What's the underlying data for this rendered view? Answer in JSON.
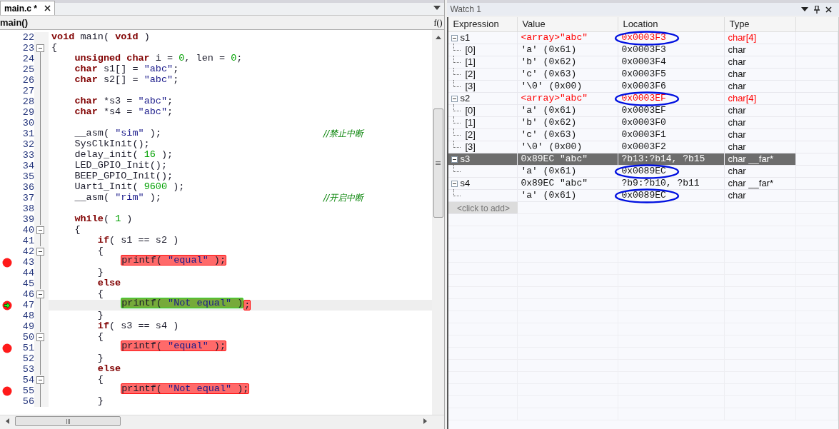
{
  "editor": {
    "tab": {
      "label": "main.c *",
      "selected": true
    },
    "function_name": "main()",
    "function_button": "f()",
    "lines": [
      {
        "number": "22",
        "collapsible": false,
        "breakpoint": false,
        "current": false,
        "segments": [
          {
            "kind": "keyword",
            "text": "void"
          },
          {
            "kind": "plain",
            "text": " main( "
          },
          {
            "kind": "keyword",
            "text": "void"
          },
          {
            "kind": "plain",
            "text": " )"
          }
        ]
      },
      {
        "number": "23",
        "collapsible": true,
        "breakpoint": false,
        "current": false,
        "segments": [
          {
            "kind": "plain",
            "text": "{"
          }
        ]
      },
      {
        "number": "24",
        "collapsible": false,
        "breakpoint": false,
        "current": false,
        "segments": [
          {
            "kind": "keyword",
            "text": "    unsigned char"
          },
          {
            "kind": "plain",
            "text": " i = "
          },
          {
            "kind": "number",
            "text": "0"
          },
          {
            "kind": "plain",
            "text": ", len = "
          },
          {
            "kind": "number",
            "text": "0"
          },
          {
            "kind": "plain",
            "text": ";"
          }
        ]
      },
      {
        "number": "25",
        "collapsible": false,
        "breakpoint": false,
        "current": false,
        "segments": [
          {
            "kind": "keyword",
            "text": "    char"
          },
          {
            "kind": "plain",
            "text": " s1[] = "
          },
          {
            "kind": "string",
            "text": "\"abc\""
          },
          {
            "kind": "plain",
            "text": ";"
          }
        ]
      },
      {
        "number": "26",
        "collapsible": false,
        "breakpoint": false,
        "current": false,
        "segments": [
          {
            "kind": "keyword",
            "text": "    char"
          },
          {
            "kind": "plain",
            "text": " s2[] = "
          },
          {
            "kind": "string",
            "text": "\"abc\""
          },
          {
            "kind": "plain",
            "text": ";"
          }
        ]
      },
      {
        "number": "27",
        "collapsible": false,
        "breakpoint": false,
        "current": false
      },
      {
        "number": "28",
        "collapsible": false,
        "breakpoint": false,
        "current": false,
        "segments": [
          {
            "kind": "keyword",
            "text": "    char"
          },
          {
            "kind": "plain",
            "text": " *s3 = "
          },
          {
            "kind": "string",
            "text": "\"abc\""
          },
          {
            "kind": "plain",
            "text": ";"
          }
        ]
      },
      {
        "number": "29",
        "collapsible": false,
        "breakpoint": false,
        "current": false,
        "segments": [
          {
            "kind": "keyword",
            "text": "    char"
          },
          {
            "kind": "plain",
            "text": " *s4 = "
          },
          {
            "kind": "string",
            "text": "\"abc\""
          },
          {
            "kind": "plain",
            "text": ";"
          }
        ]
      },
      {
        "number": "30",
        "collapsible": false,
        "breakpoint": false,
        "current": false
      },
      {
        "number": "31",
        "collapsible": false,
        "breakpoint": false,
        "current": false,
        "segments": [
          {
            "kind": "plain",
            "text": "    __asm( "
          },
          {
            "kind": "string",
            "text": "\"sim\""
          },
          {
            "kind": "plain",
            "text": " );"
          },
          {
            "kind": "comment",
            "text": "//禁止中断"
          }
        ]
      },
      {
        "number": "32",
        "collapsible": false,
        "breakpoint": false,
        "current": false,
        "segments": [
          {
            "kind": "plain",
            "text": "    SysClkInit();"
          }
        ]
      },
      {
        "number": "33",
        "collapsible": false,
        "breakpoint": false,
        "current": false,
        "segments": [
          {
            "kind": "plain",
            "text": "    delay_init( "
          },
          {
            "kind": "number",
            "text": "16"
          },
          {
            "kind": "plain",
            "text": " );"
          }
        ]
      },
      {
        "number": "34",
        "collapsible": false,
        "breakpoint": false,
        "current": false,
        "segments": [
          {
            "kind": "plain",
            "text": "    LED_GPIO_Init();"
          }
        ]
      },
      {
        "number": "35",
        "collapsible": false,
        "breakpoint": false,
        "current": false,
        "segments": [
          {
            "kind": "plain",
            "text": "    BEEP_GPIO_Init();"
          }
        ]
      },
      {
        "number": "36",
        "collapsible": false,
        "breakpoint": false,
        "current": false,
        "segments": [
          {
            "kind": "plain",
            "text": "    Uart1_Init( "
          },
          {
            "kind": "number",
            "text": "9600"
          },
          {
            "kind": "plain",
            "text": " );"
          }
        ]
      },
      {
        "number": "37",
        "collapsible": false,
        "breakpoint": false,
        "current": false,
        "segments": [
          {
            "kind": "plain",
            "text": "    __asm( "
          },
          {
            "kind": "string",
            "text": "\"rim\""
          },
          {
            "kind": "plain",
            "text": " );"
          },
          {
            "kind": "comment",
            "text": "//开启中断"
          }
        ]
      },
      {
        "number": "38",
        "collapsible": false,
        "breakpoint": false,
        "current": false
      },
      {
        "number": "39",
        "collapsible": false,
        "breakpoint": false,
        "current": false,
        "segments": [
          {
            "kind": "keyword",
            "text": "    while"
          },
          {
            "kind": "plain",
            "text": "( "
          },
          {
            "kind": "number",
            "text": "1"
          },
          {
            "kind": "plain",
            "text": " )"
          }
        ]
      },
      {
        "number": "40",
        "collapsible": true,
        "breakpoint": false,
        "current": false,
        "segments": [
          {
            "kind": "plain",
            "text": "    {"
          }
        ]
      },
      {
        "number": "41",
        "collapsible": false,
        "breakpoint": false,
        "current": false,
        "segments": [
          {
            "kind": "keyword",
            "text": "        if"
          },
          {
            "kind": "plain",
            "text": "( s1 == s2 )"
          }
        ]
      },
      {
        "number": "42",
        "collapsible": true,
        "breakpoint": false,
        "current": false,
        "segments": [
          {
            "kind": "plain",
            "text": "        {"
          }
        ]
      },
      {
        "number": "43",
        "collapsible": false,
        "breakpoint": true,
        "current": false,
        "segments": [
          {
            "kind": "plain",
            "text": "            printf( ",
            "current": false
          },
          {
            "kind": "string",
            "text": "\"equal\"",
            "current": false
          },
          {
            "kind": "plain",
            "text": " );",
            "current": false
          }
        ]
      },
      {
        "number": "44",
        "collapsible": false,
        "breakpoint": false,
        "current": false,
        "segments": [
          {
            "kind": "plain",
            "text": "        }"
          }
        ]
      },
      {
        "number": "45",
        "collapsible": false,
        "breakpoint": false,
        "current": false,
        "segments": [
          {
            "kind": "keyword",
            "text": "        else"
          }
        ]
      },
      {
        "number": "46",
        "collapsible": true,
        "breakpoint": false,
        "current": false,
        "segments": [
          {
            "kind": "plain",
            "text": "        {"
          }
        ]
      },
      {
        "number": "47",
        "collapsible": false,
        "breakpoint": true,
        "current": true,
        "segments": [
          {
            "kind": "plain",
            "text": "            printf( ",
            "current": true
          },
          {
            "kind": "string",
            "text": "\"Not equal\"",
            "current": true
          },
          {
            "kind": "plain",
            "text": " )",
            "current": true
          },
          {
            "kind": "plain",
            "text": ";",
            "current": false
          }
        ]
      },
      {
        "number": "48",
        "collapsible": false,
        "breakpoint": false,
        "current": false,
        "segments": [
          {
            "kind": "plain",
            "text": "        }"
          }
        ]
      },
      {
        "number": "49",
        "collapsible": false,
        "breakpoint": false,
        "current": false,
        "segments": [
          {
            "kind": "keyword",
            "text": "        if"
          },
          {
            "kind": "plain",
            "text": "( s3 == s4 )"
          }
        ]
      },
      {
        "number": "50",
        "collapsible": true,
        "breakpoint": false,
        "current": false,
        "segments": [
          {
            "kind": "plain",
            "text": "        {"
          }
        ]
      },
      {
        "number": "51",
        "collapsible": false,
        "breakpoint": true,
        "current": false,
        "segments": [
          {
            "kind": "plain",
            "text": "            printf( ",
            "current": false
          },
          {
            "kind": "string",
            "text": "\"equal\"",
            "current": false
          },
          {
            "kind": "plain",
            "text": " );",
            "current": false
          }
        ]
      },
      {
        "number": "52",
        "collapsible": false,
        "breakpoint": false,
        "current": false,
        "segments": [
          {
            "kind": "plain",
            "text": "        }"
          }
        ]
      },
      {
        "number": "53",
        "collapsible": false,
        "breakpoint": false,
        "current": false,
        "segments": [
          {
            "kind": "keyword",
            "text": "        else"
          }
        ]
      },
      {
        "number": "54",
        "collapsible": true,
        "breakpoint": false,
        "current": false,
        "segments": [
          {
            "kind": "plain",
            "text": "        {"
          }
        ]
      },
      {
        "number": "55",
        "collapsible": false,
        "breakpoint": true,
        "current": false,
        "segments": [
          {
            "kind": "plain",
            "text": "            printf( ",
            "current": false
          },
          {
            "kind": "string",
            "text": "\"Not equal\"",
            "current": false
          },
          {
            "kind": "plain",
            "text": " );",
            "current": false
          }
        ]
      },
      {
        "number": "56",
        "collapsible": false,
        "breakpoint": false,
        "current": false,
        "segments": [
          {
            "kind": "plain",
            "text": "        }"
          }
        ]
      }
    ]
  },
  "watch": {
    "title": "Watch 1",
    "columns": [
      "Expression",
      "Value",
      "Location",
      "Type"
    ],
    "rows": [
      {
        "expression": "s1",
        "value": "<array>\"abc\"",
        "location": "0x0003F3",
        "type": "char[4]",
        "changed": true,
        "circled": true,
        "selected": false,
        "expanded": true,
        "children": [
          {
            "expression": "[0]",
            "value": "'a' (0x61)",
            "location": "0x0003F3",
            "type": "char",
            "changed": false,
            "circled": false,
            "selected": false
          },
          {
            "expression": "[1]",
            "value": "'b' (0x62)",
            "location": "0x0003F4",
            "type": "char",
            "changed": false,
            "circled": false,
            "selected": false
          },
          {
            "expression": "[2]",
            "value": "'c' (0x63)",
            "location": "0x0003F5",
            "type": "char",
            "changed": false,
            "circled": false,
            "selected": false
          },
          {
            "expression": "[3]",
            "value": "'\\0' (0x00)",
            "location": "0x0003F6",
            "type": "char",
            "changed": false,
            "circled": false,
            "selected": false
          }
        ]
      },
      {
        "expression": "s2",
        "value": "<array>\"abc\"",
        "location": "0x0003EF",
        "type": "char[4]",
        "changed": true,
        "circled": true,
        "selected": false,
        "expanded": true,
        "children": [
          {
            "expression": "[0]",
            "value": "'a' (0x61)",
            "location": "0x0003EF",
            "type": "char",
            "changed": false,
            "circled": false,
            "selected": false
          },
          {
            "expression": "[1]",
            "value": "'b' (0x62)",
            "location": "0x0003F0",
            "type": "char",
            "changed": false,
            "circled": false,
            "selected": false
          },
          {
            "expression": "[2]",
            "value": "'c' (0x63)",
            "location": "0x0003F1",
            "type": "char",
            "changed": false,
            "circled": false,
            "selected": false
          },
          {
            "expression": "[3]",
            "value": "'\\0' (0x00)",
            "location": "0x0003F2",
            "type": "char",
            "changed": false,
            "circled": false,
            "selected": false
          }
        ]
      },
      {
        "expression": "s3",
        "value": "0x89EC \"abc\"",
        "location": "?b13:?b14, ?b15",
        "type": "char __far*",
        "changed": false,
        "circled": false,
        "selected": true,
        "expanded": true,
        "children": [
          {
            "value": "'a' (0x61)",
            "location": "0x0089EC",
            "type": "char",
            "changed": false,
            "circled": true,
            "selected": false
          }
        ]
      },
      {
        "expression": "s4",
        "value": "0x89EC \"abc\"",
        "location": "?b9:?b10, ?b11",
        "type": "char __far*",
        "changed": false,
        "circled": false,
        "selected": false,
        "expanded": true,
        "children": [
          {
            "value": "'a' (0x61)",
            "location": "0x0089EC",
            "type": "char",
            "changed": false,
            "circled": true,
            "selected": false
          }
        ]
      }
    ],
    "add_placeholder": "<click to add>"
  }
}
